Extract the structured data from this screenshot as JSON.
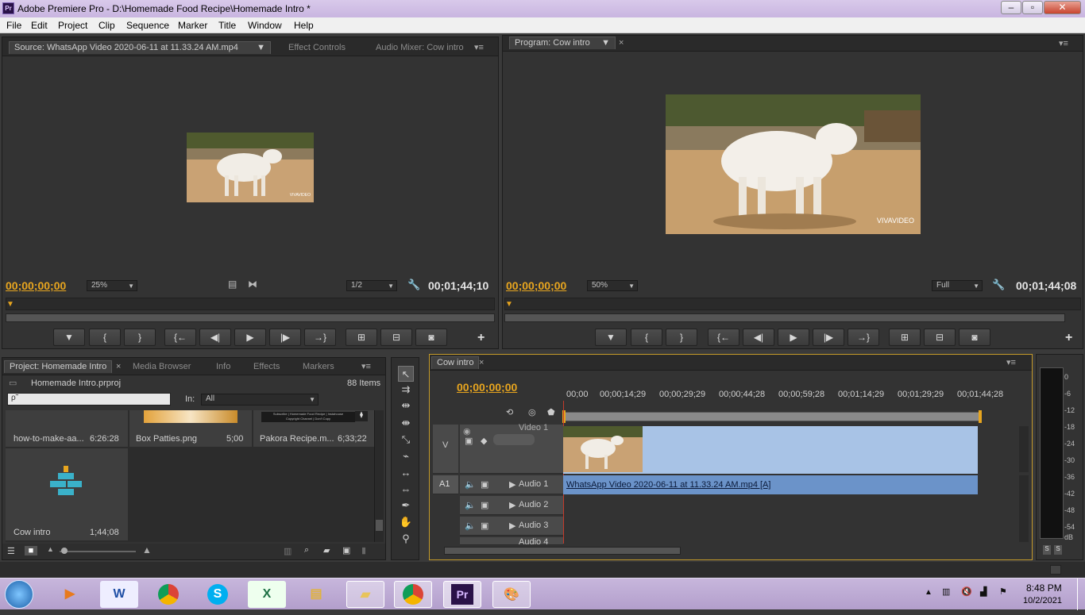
{
  "window": {
    "title": "Adobe Premiere Pro - D:\\Homemade Food Recipe\\Homemade Intro *",
    "logo": "Pr"
  },
  "menu": [
    "File",
    "Edit",
    "Project",
    "Clip",
    "Sequence",
    "Marker",
    "Title",
    "Window",
    "Help"
  ],
  "source": {
    "tabs": [
      "Source: WhatsApp Video 2020-06-11 at 11.33.24 AM.mp4",
      "Effect Controls",
      "Audio Mixer: Cow intro"
    ],
    "timecode": "00;00;00;00",
    "zoom": "25%",
    "resolution": "1/2",
    "duration": "00;01;44;10",
    "watermark": "VIVAVIDEO"
  },
  "program": {
    "tab": "Program: Cow intro",
    "timecode": "00;00;00;00",
    "zoom": "50%",
    "resolution": "Full",
    "duration": "00;01;44;08",
    "watermark": "VIVAVIDEO"
  },
  "transport": {
    "marker": "▼",
    "in": "{",
    "out": "}",
    "goto_in": "{←",
    "step_back": "◀|",
    "play": "▶",
    "step_fwd": "|▶",
    "goto_out": "→}",
    "add": "+"
  },
  "project": {
    "tabs": [
      "Project: Homemade Intro",
      "Media Browser",
      "Info",
      "Effects",
      "Markers"
    ],
    "file": "Homemade Intro.prproj",
    "items_count": "88 Items",
    "search_placeholder": "ρ˜",
    "in_label": "In:",
    "in_value": "All",
    "bins": [
      {
        "name": "how-to-make-aa...",
        "duration": "6:26:28"
      },
      {
        "name": "Box Patties.png",
        "duration": "5;00"
      },
      {
        "name": "Pakora Recipe.m...",
        "duration": "6;33;22",
        "subtitle1": "Subscribe | Homemade Food Recipe | Instahouse",
        "subtitle2": "Copyright Channel | Don't Copy"
      },
      {
        "name": "Cow intro",
        "duration": "1;44;08"
      }
    ]
  },
  "timeline": {
    "tab": "Cow intro",
    "timecode": "00;00;00;00",
    "ruler": [
      "00;00",
      "00;00;14;29",
      "00;00;29;29",
      "00;00;44;28",
      "00;00;59;28",
      "00;01;14;29",
      "00;01;29;29",
      "00;01;44;28"
    ],
    "video_label": "V",
    "video_track": "Video 1",
    "audio_label": "A1",
    "audio_tracks": [
      "Audio 1",
      "Audio 2",
      "Audio 3",
      "Audio 4"
    ],
    "audio_clip": "WhatsApp Video 2020-06-11 at 11.33.24 AM.mp4 [A]"
  },
  "meter": {
    "ticks": [
      "0",
      "-6",
      "-12",
      "-18",
      "-24",
      "-30",
      "-36",
      "-42",
      "-48",
      "-54",
      "dB"
    ],
    "solo": "S"
  },
  "taskbar": {
    "time": "8:48 PM",
    "date": "10/2/2021",
    "pr": "Pr",
    "word": "W",
    "excel": "X",
    "skype": "S"
  }
}
